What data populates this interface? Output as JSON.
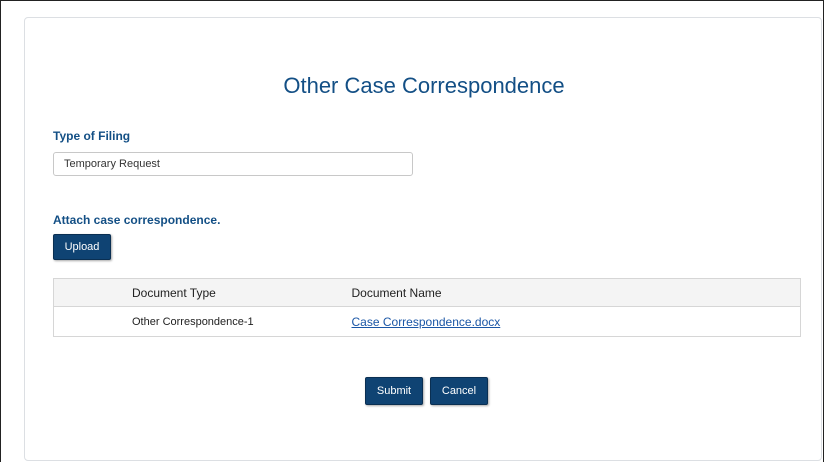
{
  "page": {
    "title": "Other Case Correspondence"
  },
  "filing": {
    "label": "Type of Filing",
    "value": "Temporary Request"
  },
  "attachments": {
    "label": "Attach case correspondence.",
    "upload_label": "Upload",
    "columns": [
      "Document Type",
      "Document Name"
    ],
    "rows": [
      {
        "type": "Other Correspondence-1",
        "name": "Case Correspondence.docx"
      }
    ]
  },
  "actions": {
    "submit_label": "Submit",
    "cancel_label": "Cancel"
  },
  "colors": {
    "accent": "#134f85",
    "button": "#0f4373",
    "link": "#1a56a6"
  }
}
